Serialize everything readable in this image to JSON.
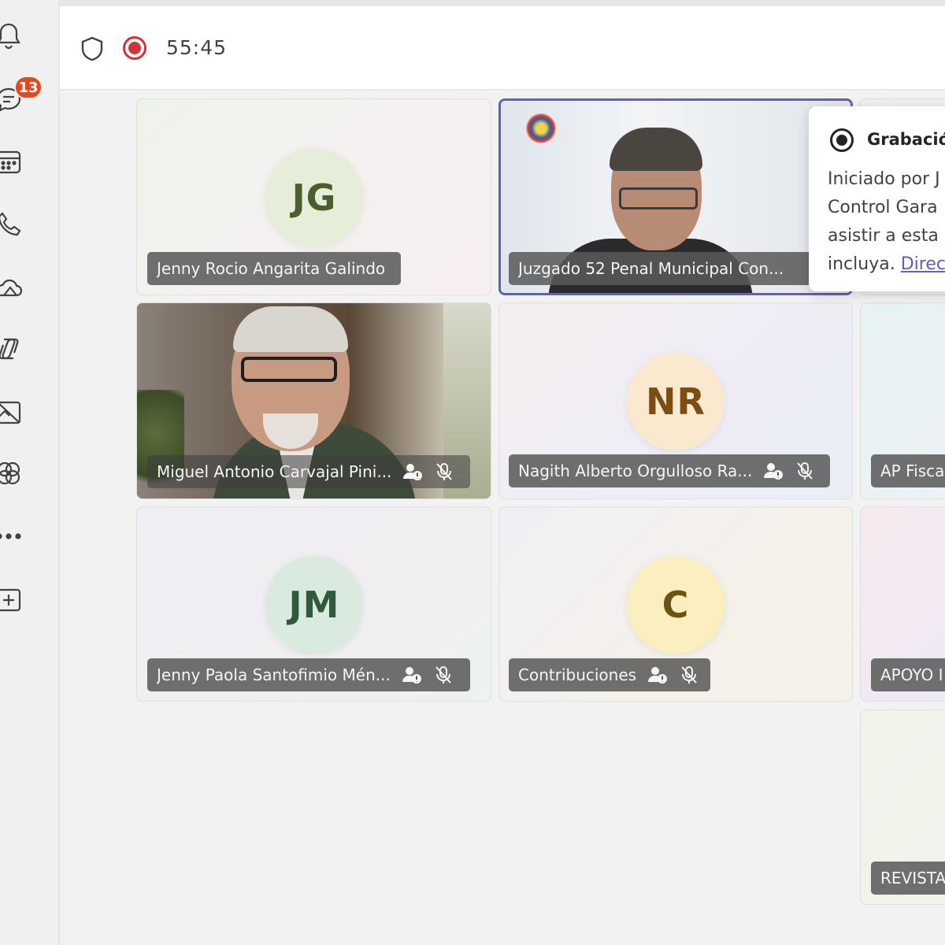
{
  "rail": {
    "badge_count": "13",
    "items": [
      {
        "name": "activity-bell-icon"
      },
      {
        "name": "chat-icon"
      },
      {
        "name": "calendar-icon"
      },
      {
        "name": "calls-icon"
      },
      {
        "name": "onedrive-icon"
      },
      {
        "name": "copilot-icon"
      },
      {
        "name": "apps-image-icon"
      },
      {
        "name": "loop-icon"
      },
      {
        "name": "more-icon"
      },
      {
        "name": "add-apps-icon"
      }
    ]
  },
  "header": {
    "timer": "55:45",
    "recording_color": "#d13438"
  },
  "participants": [
    {
      "name": "Jenny Rocio Angarita Galindo",
      "initials": "JG",
      "type": "avatar"
    },
    {
      "name": "Juzgado 52 Penal Municipal Con...",
      "type": "video",
      "active": true
    },
    {
      "name": "Miguel Antonio Carvajal Pini...",
      "type": "video"
    },
    {
      "name": "Nagith Alberto Orgulloso Ra...",
      "initials": "NR",
      "type": "avatar"
    },
    {
      "name": "AP Fisca",
      "type": "avatar"
    },
    {
      "name": "Jenny Paola Santofimio Mén...",
      "initials": "JM",
      "type": "avatar"
    },
    {
      "name": "Contribuciones",
      "initials": "C",
      "type": "avatar"
    },
    {
      "name": "APOYO I",
      "type": "avatar"
    },
    {
      "name": "REVISTA",
      "type": "avatar"
    }
  ],
  "popover": {
    "title": "Grabación",
    "lines": [
      "Iniciado por J",
      "Control Gara",
      "asistir a esta"
    ],
    "last_line_prefix": "incluya.",
    "link_text": "Direc"
  },
  "colors": {
    "active_border": "#6264a7",
    "badge": "#e8461f",
    "link": "#5b5fc7"
  }
}
